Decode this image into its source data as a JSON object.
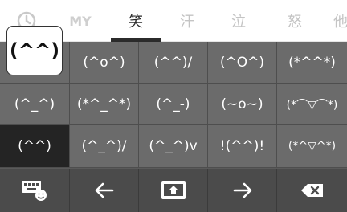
{
  "tabs": {
    "recent_icon": "clock-icon",
    "my": "MY",
    "items": [
      "笑",
      "汗",
      "泣",
      "怒",
      "他"
    ],
    "active_index": 0
  },
  "preview": "(^^)",
  "grid": [
    [
      "",
      "(^o^)",
      "(^^)/",
      "(^O^)",
      "(*^^*)"
    ],
    [
      "(^_^)",
      "(*^_^*)",
      "(^_-)",
      "(~o~)",
      "(*⌒▽⌒*)"
    ],
    [
      "(^^)",
      "(^_^)/",
      "(^_^)v",
      "!(^^)!",
      "(*^▽^*)"
    ]
  ],
  "selected": {
    "row": 2,
    "col": 0
  },
  "bottom_keys": [
    "keyboard-emoji-icon",
    "arrow-left-icon",
    "input-box-icon",
    "arrow-right-icon",
    "backspace-icon"
  ],
  "colors": {
    "key_bg": "#6b6b6b",
    "selected_bg": "#242424",
    "bottom_bg": "#4b4b4b",
    "tab_active": "#2b2b2b",
    "tab_inactive": "#c4c4c4"
  }
}
